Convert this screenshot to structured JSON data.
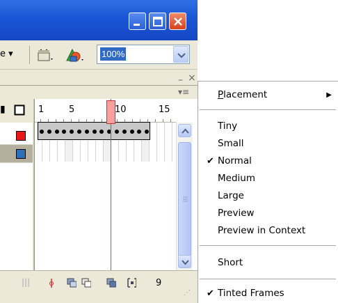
{
  "toolbar": {
    "edit_label_fragment": "e",
    "zoom_value": "100%"
  },
  "timeline": {
    "ruler_numbers": [
      "1",
      "5",
      "10",
      "15"
    ],
    "layer_colors": [
      "#e81818",
      "#2a6fb8"
    ],
    "first_frame_marker": "o",
    "current_frame": "9"
  },
  "menu": {
    "placement": {
      "pre": "",
      "accel": "P",
      "post": "lacement"
    },
    "items_size": [
      "Tiny",
      "Small",
      "Normal",
      "Medium",
      "Large",
      "Preview",
      "Preview in Context"
    ],
    "checked_size": "Normal",
    "short": "Short",
    "tinted_frames": "Tinted Frames",
    "check_mark": "✔",
    "submenu_arrow": "▶"
  },
  "colors": {
    "titlebar": "#1a56d6",
    "selection": "#316ac5",
    "playhead": "#e04040"
  }
}
